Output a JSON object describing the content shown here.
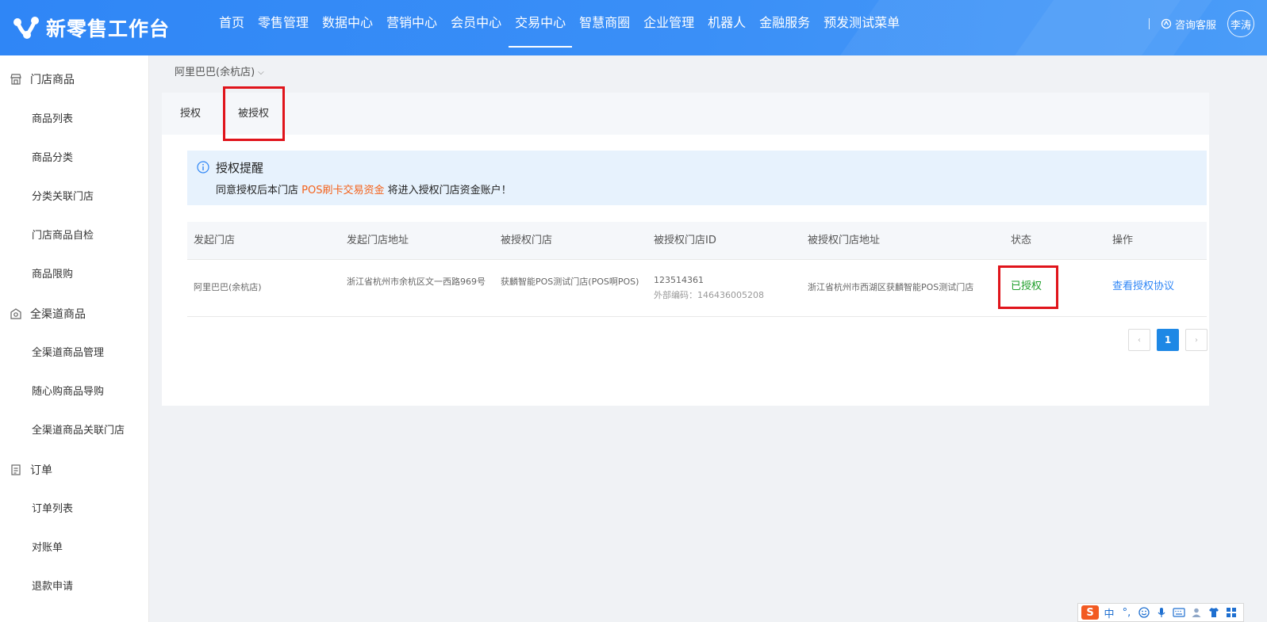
{
  "header": {
    "app_title": "新零售工作台",
    "nav": [
      {
        "label": "首页",
        "active": false
      },
      {
        "label": "零售管理",
        "active": false
      },
      {
        "label": "数据中心",
        "active": false
      },
      {
        "label": "营销中心",
        "active": false
      },
      {
        "label": "会员中心",
        "active": false
      },
      {
        "label": "交易中心",
        "active": true
      },
      {
        "label": "智慧商圈",
        "active": false
      },
      {
        "label": "企业管理",
        "active": false
      },
      {
        "label": "机器人",
        "active": false
      },
      {
        "label": "金融服务",
        "active": false
      },
      {
        "label": "预发测试菜单",
        "active": false
      }
    ],
    "service_label": "咨询客服",
    "user_name": "李涛"
  },
  "sidebar": {
    "groups": [
      {
        "label": "门店商品",
        "icon": "store-icon",
        "items": [
          "商品列表",
          "商品分类",
          "分类关联门店",
          "门店商品自检",
          "商品限购"
        ]
      },
      {
        "label": "全渠道商品",
        "icon": "channel-icon",
        "items": [
          "全渠道商品管理",
          "随心购商品导购",
          "全渠道商品关联门店"
        ]
      },
      {
        "label": "订单",
        "icon": "order-icon",
        "items": [
          "订单列表",
          "对账单",
          "退款申请"
        ]
      }
    ]
  },
  "store_selector": {
    "value": "阿里巴巴(余杭店)"
  },
  "tabs": [
    {
      "label": "授权",
      "active": false
    },
    {
      "label": "被授权",
      "active": true
    }
  ],
  "alert": {
    "title": "授权提醒",
    "desc_before": "同意授权后本门店",
    "desc_highlight": "POS刷卡交易资金",
    "desc_after": "将进入授权门店资金账户！"
  },
  "table": {
    "columns": [
      "发起门店",
      "发起门店地址",
      "被授权门店",
      "被授权门店ID",
      "被授权门店地址",
      "状态",
      "操作"
    ],
    "rows": [
      {
        "origin_store": "阿里巴巴(余杭店)",
        "origin_address": "浙江省杭州市余杭区文一西路969号",
        "auth_store": "获麟智能POS测试门店(POS啊POS)",
        "auth_store_id": "123514361",
        "external_code": "外部编码：146436005208",
        "auth_address": "浙江省杭州市西湖区获麟智能POS测试门店",
        "status": "已授权",
        "action": "查看授权协议"
      }
    ]
  },
  "pagination": {
    "current": "1",
    "prev": "‹",
    "next": "›"
  },
  "ime": {
    "logo": "S",
    "mode": "中",
    "punct": "°,",
    "icons": [
      "emoji-icon",
      "mic-icon",
      "keyboard-icon",
      "user-icon",
      "shirt-icon",
      "grid-icon"
    ]
  },
  "colors": {
    "header_blue": "#2f86f6",
    "accent_orange": "#f4611a",
    "status_green": "#1e9e2a",
    "highlight_red": "#e0141b"
  }
}
